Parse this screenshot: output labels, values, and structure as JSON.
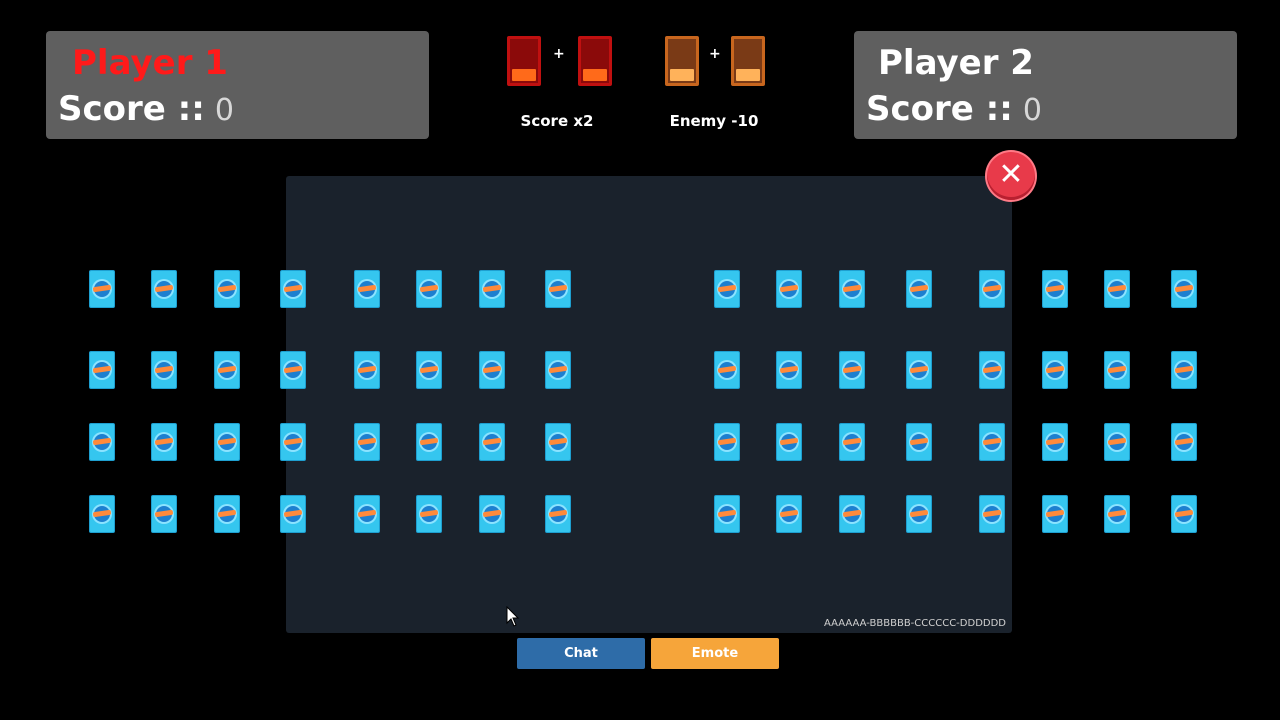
{
  "player1": {
    "name": "Player 1",
    "score_label": "Score ::",
    "score": "0"
  },
  "player2": {
    "name": "Player 2",
    "score_label": "Score ::",
    "score": "0"
  },
  "combos": [
    {
      "label": "Score x2",
      "card_color": "#8b0a0a"
    },
    {
      "label": "Enemy -10",
      "card_color": "#7a3a16"
    }
  ],
  "board": {
    "code": "AAAAAA-BBBBBB-CCCCCC-DDDDDD"
  },
  "controls": {
    "chat_label": "Chat",
    "emote_label": "Emote",
    "close_icon": "close-icon"
  },
  "grid": {
    "rows": 4,
    "columns": 16,
    "card_back_icon": "card-back-icon"
  },
  "colors": {
    "player1": "#ff1a1a",
    "chat": "#2e6ca8",
    "emote": "#f6a53a",
    "close": "#e83a4a",
    "card": "#35c6ef"
  }
}
